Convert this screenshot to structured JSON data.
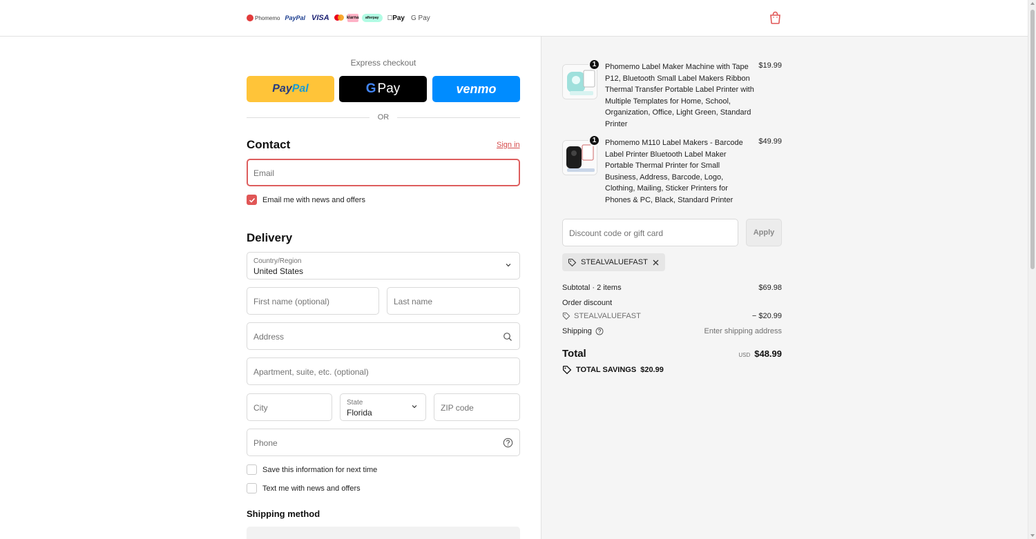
{
  "header": {
    "brand": "Phomemo",
    "payment_marks": [
      "PayPal",
      "VISA",
      "klarna",
      "afterpay",
      "Pay",
      "G Pay"
    ],
    "cart_icon": "shopping-bag-icon"
  },
  "express": {
    "title": "Express checkout",
    "paypal_pay": "Pay",
    "paypal_pal": "Pal",
    "gpay_g": "G",
    "gpay_label": "Pay",
    "venmo_label": "venmo",
    "or_label": "OR"
  },
  "contact": {
    "heading": "Contact",
    "sign_in": "Sign in",
    "email_placeholder": "Email",
    "news_checkbox_label": "Email me with news and offers",
    "news_checked": true
  },
  "delivery": {
    "heading": "Delivery",
    "country_label": "Country/Region",
    "country_value": "United States",
    "first_name_placeholder": "First name (optional)",
    "last_name_placeholder": "Last name",
    "address_placeholder": "Address",
    "apartment_placeholder": "Apartment, suite, etc. (optional)",
    "city_placeholder": "City",
    "state_label": "State",
    "state_value": "Florida",
    "zip_placeholder": "ZIP code",
    "phone_placeholder": "Phone",
    "save_info_label": "Save this information for next time",
    "text_me_label": "Text me with news and offers"
  },
  "shipping_method": {
    "heading": "Shipping method"
  },
  "order": {
    "items": [
      {
        "title": "Phomemo Label Maker Machine with Tape P12, Bluetooth Small Label Makers Ribbon Thermal Transfer Portable Label Printer with Multiple Templates for Home, School, Organization, Office, Light Green, Standard Printer",
        "price": "$19.99",
        "quantity": "1"
      },
      {
        "title": "Phomemo M110 Label Makers - Barcode Label Printer Bluetooth Label Maker Portable Thermal Printer for Small Business, Address, Barcode, Logo, Clothing, Mailing, Sticker Printers for Phones & PC, Black, Standard Printer",
        "price": "$49.99",
        "quantity": "1"
      }
    ],
    "discount_placeholder": "Discount code or gift card",
    "apply_label": "Apply",
    "applied_code": "STEALVALUEFAST",
    "subtotal_label": "Subtotal · 2 items",
    "subtotal_value": "$69.98",
    "order_discount_label": "Order discount",
    "discount_code": "STEALVALUEFAST",
    "discount_value": "− $20.99",
    "shipping_label": "Shipping",
    "shipping_value": "Enter shipping address",
    "total_label": "Total",
    "currency": "USD",
    "total_value": "$48.99",
    "savings_label": "TOTAL SAVINGS",
    "savings_value": "$20.99"
  },
  "colors": {
    "accent": "#e05656",
    "error_border": "#dd5d5d",
    "paypal_yellow": "#ffc439",
    "venmo_blue": "#008cff",
    "sidebar_bg": "#f5f5f5"
  }
}
